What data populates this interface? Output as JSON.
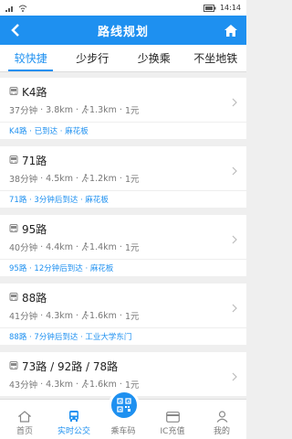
{
  "statusbar": {
    "icons_left": "sim-wifi-icons",
    "time": "14:14"
  },
  "header": {
    "title": "路线规划"
  },
  "tabs": [
    {
      "label": "较快捷"
    },
    {
      "label": "少步行"
    },
    {
      "label": "少换乘"
    },
    {
      "label": "不坐地铁"
    }
  ],
  "routes": [
    {
      "name": "K4路",
      "duration": "37分钟",
      "distance": "3.8km",
      "walk": "1.3km",
      "fare": "1元",
      "status": "K4路 · 已到达 · 麻花板"
    },
    {
      "name": "71路",
      "duration": "38分钟",
      "distance": "4.5km",
      "walk": "1.2km",
      "fare": "1元",
      "status": "71路 · 3分钟后到达 · 麻花板"
    },
    {
      "name": "95路",
      "duration": "40分钟",
      "distance": "4.4km",
      "walk": "1.4km",
      "fare": "1元",
      "status": "95路 · 12分钟后到达 · 麻花板"
    },
    {
      "name": "88路",
      "duration": "41分钟",
      "distance": "4.3km",
      "walk": "1.6km",
      "fare": "1元",
      "status": "88路 · 7分钟后到达 · 工业大学东门"
    },
    {
      "name": "73路 / 92路 / 78路",
      "duration": "43分钟",
      "distance": "4.3km",
      "walk": "1.6km",
      "fare": "1元",
      "status": ""
    }
  ],
  "tabbar": [
    {
      "label": "首页"
    },
    {
      "label": "实时公交"
    },
    {
      "label": "乘车码"
    },
    {
      "label": "IC充值"
    },
    {
      "label": "我的"
    }
  ],
  "colors": {
    "accent": "#1e90f0"
  }
}
